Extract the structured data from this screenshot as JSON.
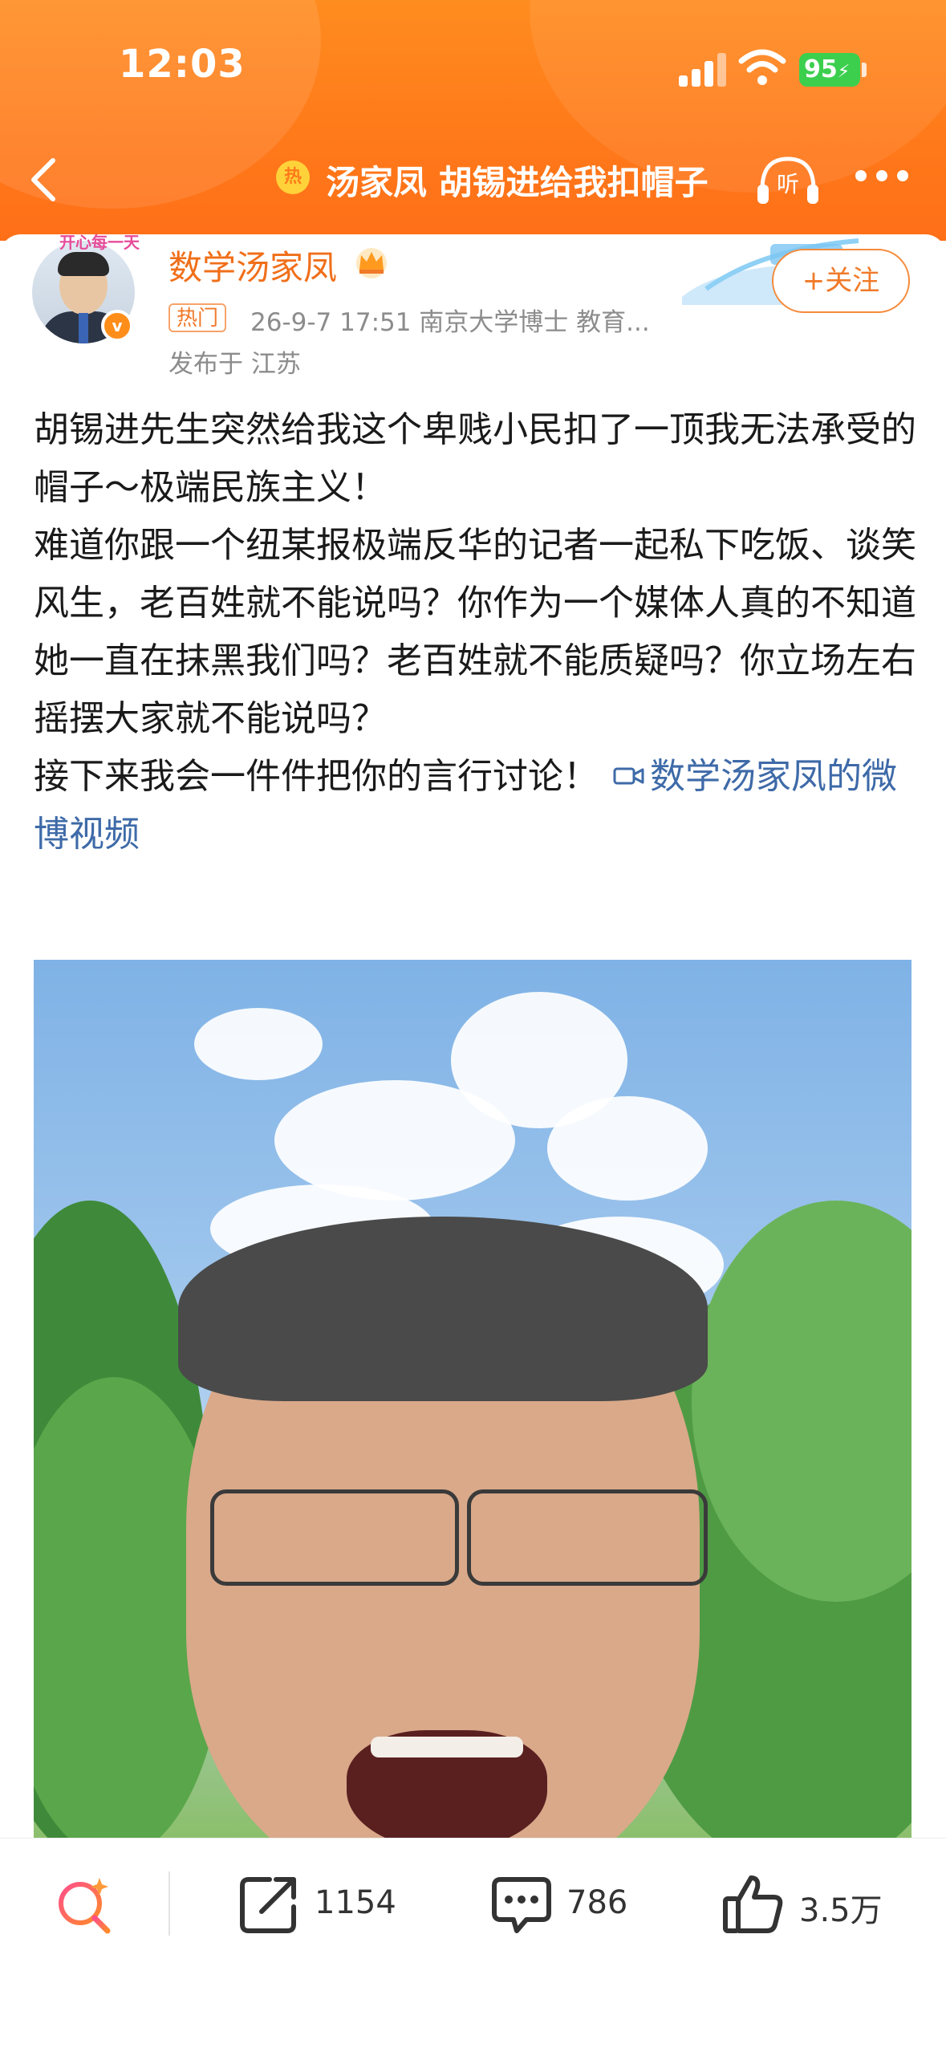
{
  "status_bar": {
    "time": "12:03",
    "battery": "95"
  },
  "nav": {
    "title": "汤家凤 胡锡进给我扣帽子",
    "hot_icon": "热",
    "listen_label": "听"
  },
  "author": {
    "name": "数学汤家凤",
    "hot_tag": "热门",
    "meta": "26-9-7 17:51  南京大学博士 教育...",
    "location": "发布于 江苏",
    "follow_label": "+关注",
    "avatar_tag": "开心每一天",
    "verified_mark": "v"
  },
  "post": {
    "paragraphs": [
      "胡锡进先生突然给我这个卑贱小民扣了一顶我无法承受的帽子～极端民族主义！",
      "难道你跟一个纽某报极端反华的记者一起私下吃饭、谈笑风生，老百姓就不能说吗？你作为一个媒体人真的不知道她一直在抹黑我们吗？老百姓就不能质疑吗？你立场左右摇摆大家就不能说吗？",
      "接下来我会一件件把你的言行讨论！"
    ],
    "video_link": "数学汤家凤的微博视频"
  },
  "actions": {
    "repost_count": "1154",
    "comment_count": "786",
    "like_count": "3.5万"
  },
  "colors": {
    "header": "#ff7a1a",
    "accent": "#f07a2a",
    "link": "#3e6aa8"
  },
  "icons": [
    "back-icon",
    "listen-icon",
    "more-icon",
    "crown-icon",
    "search-spark-icon",
    "repost-icon",
    "comment-icon",
    "like-icon",
    "video-camera-icon"
  ]
}
